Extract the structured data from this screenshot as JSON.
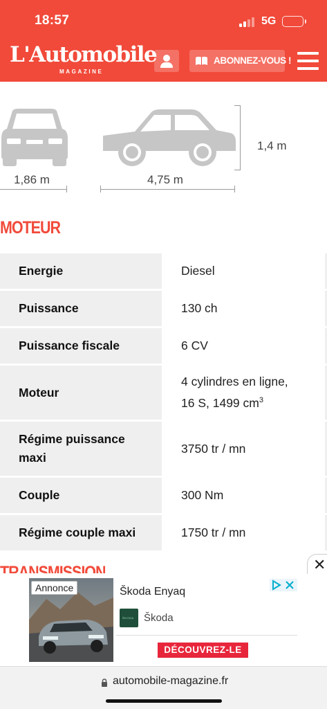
{
  "status_bar": {
    "time": "18:57",
    "network": "5G"
  },
  "header": {
    "logo": "L'Automobile",
    "logo_sub": "MAGAZINE",
    "subscribe_label": "ABONNEZ-VOUS !"
  },
  "dimensions": {
    "width": "1,86 m",
    "length": "4,75 m",
    "height": "1,4 m"
  },
  "engine_section": {
    "title": "MOTEUR",
    "rows": [
      {
        "label": "Energie",
        "value": "Diesel"
      },
      {
        "label": "Puissance",
        "value": "130 ch"
      },
      {
        "label": "Puissance fiscale",
        "value": "6 CV"
      },
      {
        "label": "Moteur",
        "value_line1": "4 cylindres en ligne,",
        "value_line2": "16 S, 1499 cm",
        "value_sup": "3"
      },
      {
        "label_line1": "Régime puissance",
        "label_line2": "maxi",
        "value": "3750 tr / mn"
      },
      {
        "label": "Couple",
        "value": "300 Nm"
      },
      {
        "label": "Régime couple maxi",
        "value": "1750 tr / mn"
      }
    ]
  },
  "next_section": {
    "title": "TRANSMISSION"
  },
  "ad": {
    "badge": "Annonce",
    "title": "Škoda Enyaq",
    "brand": "Škoda",
    "brand_logo_text": "ŠKODA",
    "cta": "DÉCOUVREZ-LE",
    "close_glyph": "✕"
  },
  "browser": {
    "url": "automobile-magazine.fr"
  },
  "colors": {
    "brand_red": "#f14a3a",
    "ad_cta": "#e8263b",
    "car_gray": "#c6c6c6"
  }
}
